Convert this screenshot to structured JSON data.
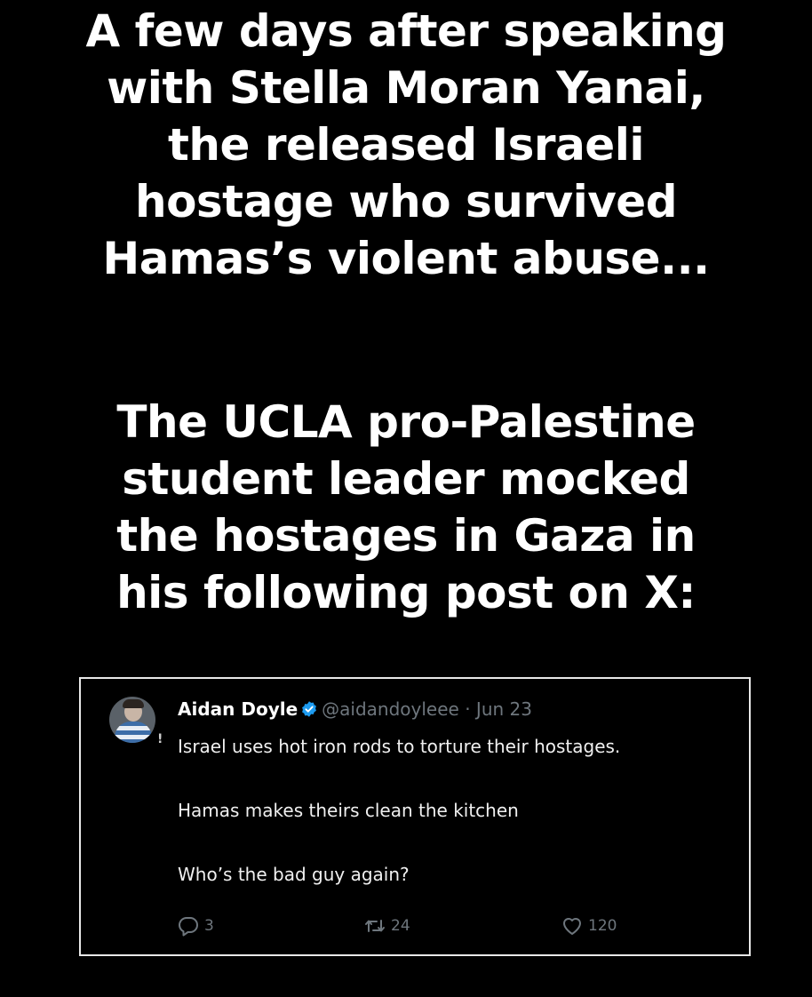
{
  "headline_top": [
    "A few days after speaking",
    "with Stella Moran Yanai,",
    "the released Israeli",
    "hostage who survived",
    "Hamas’s violent abuse..."
  ],
  "headline_bottom": [
    "The UCLA pro-Palestine",
    "student leader mocked",
    "the hostages in Gaza in",
    "his following post on X:"
  ],
  "tweet": {
    "name": "Aidan Doyle",
    "handle": "@aidandoyleee",
    "separator": "·",
    "date": "Jun 23",
    "avatar_mark": "!",
    "lines": [
      "Israel uses hot iron rods to torture their hostages.",
      "Hamas makes theirs clean the kitchen",
      "Who’s the bad guy again?"
    ],
    "replies": "3",
    "retweets": "24",
    "likes": "120",
    "verified_color": "#1d9bf0",
    "icons": {
      "verified": "verified-badge-icon",
      "reply": "reply-icon",
      "retweet": "retweet-icon",
      "like": "heart-icon"
    }
  }
}
